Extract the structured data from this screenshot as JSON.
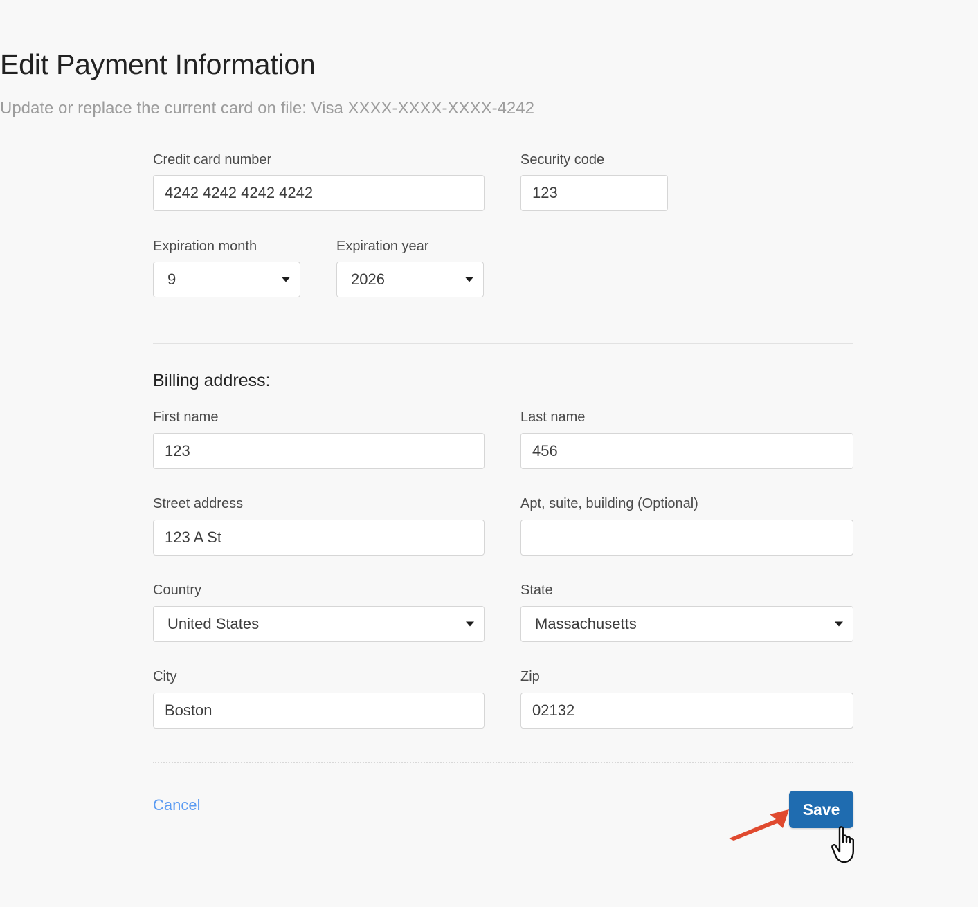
{
  "page": {
    "title": "Edit Payment Information",
    "subtitle": "Update or replace the current card on file: Visa XXXX-XXXX-XXXX-4242",
    "background_color": "#f8f8f8"
  },
  "card_section": {
    "credit_card_number": {
      "label": "Credit card number",
      "value": "4242 4242 4242 4242",
      "placeholder": ""
    },
    "security_code": {
      "label": "Security code",
      "value": "123",
      "placeholder": ""
    },
    "expiration_month": {
      "label": "Expiration month",
      "value": "9"
    },
    "expiration_year": {
      "label": "Expiration year",
      "value": "2026"
    }
  },
  "billing": {
    "heading": "Billing address:",
    "first_name": {
      "label": "First name",
      "value": "123",
      "placeholder": ""
    },
    "last_name": {
      "label": "Last name",
      "value": "456",
      "placeholder": ""
    },
    "street_address": {
      "label": "Street address",
      "value": "123 A St",
      "placeholder": ""
    },
    "apt_suite": {
      "label": "Apt, suite, building (Optional)",
      "value": "",
      "placeholder": ""
    },
    "country": {
      "label": "Country",
      "value": "United States"
    },
    "state": {
      "label": "State",
      "value": "Massachusetts"
    },
    "city": {
      "label": "City",
      "value": "Boston",
      "placeholder": ""
    },
    "zip": {
      "label": "Zip",
      "value": "02132",
      "placeholder": ""
    }
  },
  "footer": {
    "cancel_label": "Cancel",
    "save_label": "Save",
    "save_color": "#1f6cb0",
    "cancel_color": "#5b9bf2"
  },
  "annotation": {
    "arrow_color": "#e04a2f",
    "cursor": "pointer-hand-cursor"
  }
}
